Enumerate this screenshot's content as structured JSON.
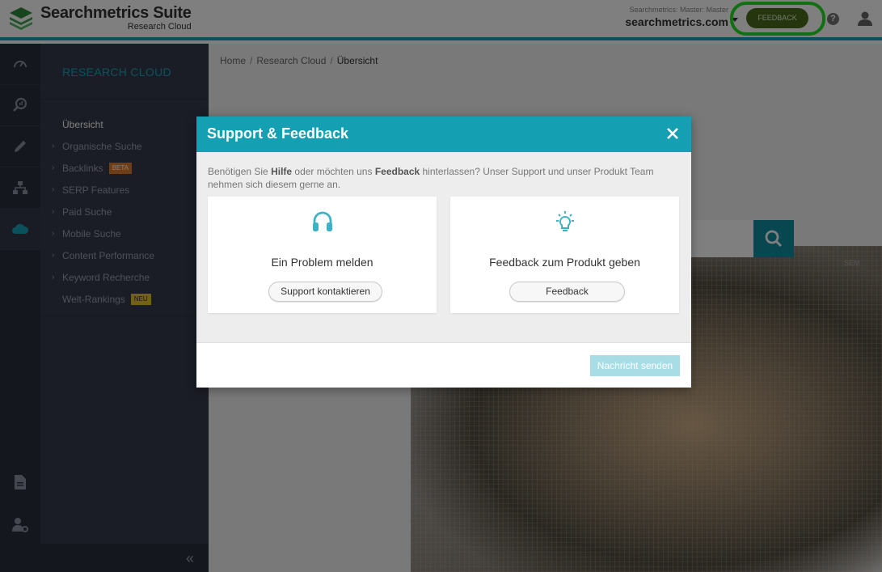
{
  "header": {
    "app_title": "Searchmetrics Suite",
    "app_subtitle": "Research Cloud",
    "account_label": "Searchmetrics: Master: Master",
    "account_domain": "searchmetrics.com",
    "feedback_label": "FEEDBACK",
    "help_glyph": "?",
    "feedback_color": "#4a6b1a",
    "highlight_color": "#22e022"
  },
  "rail": {
    "items": [
      "dashboard-icon",
      "search-analysis-icon",
      "pencil-icon",
      "sitemap-icon",
      "cloud-icon"
    ],
    "bottom_items": [
      "document-icon",
      "user-settings-icon"
    ]
  },
  "sidenav": {
    "title": "RESEARCH CLOUD",
    "items": [
      {
        "label": "Übersicht"
      },
      {
        "label": "Organische Suche"
      },
      {
        "label": "Backlinks",
        "badge": "BETA"
      },
      {
        "label": "SERP Features"
      },
      {
        "label": "Paid Suche"
      },
      {
        "label": "Mobile Suche"
      },
      {
        "label": "Content Performance"
      },
      {
        "label": "Keyword Recherche"
      },
      {
        "label": "Welt-Rankings",
        "badge": "NEU"
      }
    ],
    "collapse_glyph": "«"
  },
  "breadcrumb": {
    "items": [
      "Home",
      "Research Cloud",
      "Übersicht"
    ],
    "separator": "/"
  },
  "main": {
    "search_placeholder": "n...",
    "sem_label": "SEM"
  },
  "modal": {
    "title": "Support & Feedback",
    "desc_1": "Benötigen Sie ",
    "desc_bold_1": "Hilfe",
    "desc_2": " oder möchten uns ",
    "desc_bold_2": "Feedback",
    "desc_3": " hinterlassen? Unser Support und unser Produkt Team nehmen sich diesem gerne an.",
    "cards": [
      {
        "title": "Ein Problem melden",
        "button": "Support kontaktieren",
        "icon": "headphones-icon"
      },
      {
        "title": "Feedback zum Produkt geben",
        "button": "Feedback",
        "icon": "lightbulb-icon"
      }
    ],
    "send_label": "Nachricht senden",
    "accent_color": "#149fb3"
  }
}
